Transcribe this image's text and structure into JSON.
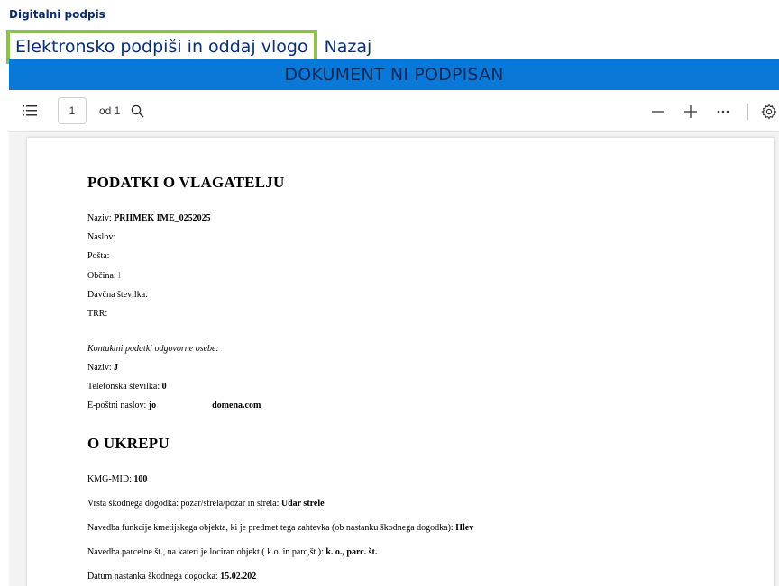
{
  "header": {
    "title": "Digitalni podpis",
    "sign_label": "Elektronsko podpiši in oddaj vlogo",
    "back_label": "Nazaj"
  },
  "banner": {
    "status": "DOKUMENT NI PODPISAN"
  },
  "toolbar": {
    "page_value": "1",
    "page_of": "od 1",
    "icons": [
      "toc-icon",
      "search-icon",
      "zoom-out-icon",
      "zoom-in-icon",
      "more-icon",
      "settings-icon"
    ]
  },
  "document": {
    "section1_title": "PODATKI O VLAGATELJU",
    "naziv_label": "Naziv: ",
    "naziv_value": "PRIIMEK IME_0252025",
    "naslov_label": "Naslov:",
    "posta_label": "Pošta:",
    "obcina_label": "Občina:",
    "obcina_value": "l",
    "davcna_label": "Davčna številka:",
    "trr_label": "TRR:",
    "contact_heading": "Kontaktni podatki odgovorne osebe:",
    "contact_naziv_label": "Naziv: ",
    "contact_naziv_value": "J",
    "phone_label": "Telefonska številka: ",
    "phone_value": "0",
    "email_label": "E-poštni naslov: ",
    "email_value_start": "jo",
    "email_value_end": "domena.com",
    "section2_title": "O UKREPU",
    "kmg_label": "KMG-MID: ",
    "kmg_value": "100",
    "vrsta_label": "Vrsta škodnega dogodka: požar/strela/požar in strela: ",
    "vrsta_value": "Udar strele",
    "funkcija_label": "Navedba funkcije kmetijskega objekta, ki je predmet tega zahtevka (ob nastanku škodnega dogodka): ",
    "funkcija_value": "Hlev",
    "parcela_label": "Navedba parcelne št., na kateri je lociran objekt ( k.o. in parc,št.): ",
    "parcela_value": "k. o., parc. št.",
    "datum_label": "Datum nastanka škodnega dogodka: ",
    "datum_value": "15.02.202"
  },
  "colors": {
    "banner_bg": "#0a78d7",
    "highlight_border": "#8bc34a",
    "link_text": "#0a2f75"
  }
}
